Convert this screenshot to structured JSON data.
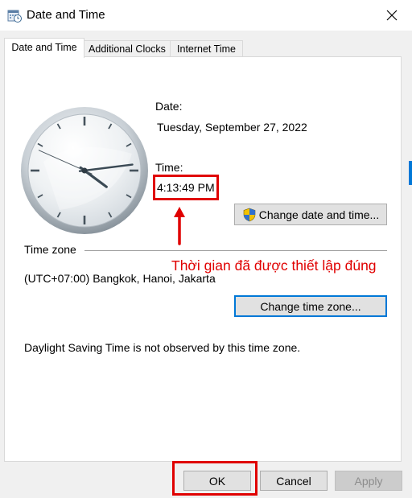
{
  "window": {
    "title": "Date and Time",
    "icon": "calendar-clock-icon",
    "close_icon": "close-icon"
  },
  "tabs": [
    {
      "label": "Date and Time",
      "active": true
    },
    {
      "label": "Additional Clocks",
      "active": false
    },
    {
      "label": "Internet Time",
      "active": false
    }
  ],
  "date": {
    "label": "Date:",
    "value": "Tuesday, September 27, 2022"
  },
  "time": {
    "label": "Time:",
    "value": "4:13:49 PM"
  },
  "clock": {
    "hours": 4,
    "minutes": 13,
    "seconds": 49
  },
  "buttons": {
    "change_date_time": "Change date and time...",
    "change_time_zone": "Change time zone...",
    "ok": "OK",
    "cancel": "Cancel",
    "apply": "Apply"
  },
  "timezone": {
    "heading": "Time zone",
    "value": "(UTC+07:00) Bangkok, Hanoi, Jakarta",
    "dst_note": "Daylight Saving Time is not observed by this time zone."
  },
  "annotation": {
    "text": "Thời gian đã được thiết lập đúng",
    "color": "#e00000"
  },
  "colors": {
    "accent": "#0078d7",
    "highlight": "#e00000"
  }
}
